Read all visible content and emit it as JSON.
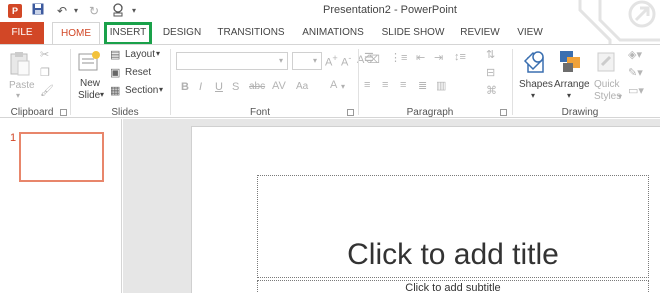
{
  "window": {
    "title": "Presentation2 - PowerPoint",
    "app_badge": "P"
  },
  "quick_access": [
    "save-icon",
    "undo-icon",
    "redo-icon",
    "present-icon"
  ],
  "tabs": [
    {
      "label": "FILE"
    },
    {
      "label": "HOME"
    },
    {
      "label": "INSERT"
    },
    {
      "label": "DESIGN"
    },
    {
      "label": "TRANSITIONS"
    },
    {
      "label": "ANIMATIONS"
    },
    {
      "label": "SLIDE SHOW"
    },
    {
      "label": "REVIEW"
    },
    {
      "label": "VIEW"
    }
  ],
  "ribbon": {
    "clipboard": {
      "paste": "Paste",
      "label": "Clipboard"
    },
    "slides": {
      "new_slide_1": "New",
      "new_slide_2": "Slide",
      "layout": "Layout",
      "reset": "Reset",
      "section": "Section",
      "label": "Slides"
    },
    "font": {
      "label": "Font",
      "bold": "B",
      "italic": "I",
      "underline": "U",
      "strike": "S",
      "abc": "abc",
      "size_a": "Aa"
    },
    "paragraph": {
      "label": "Paragraph"
    },
    "drawing": {
      "shapes": "Shapes",
      "arrange": "Arrange",
      "quick_1": "Quick",
      "quick_2": "Styles",
      "label": "Drawing"
    }
  },
  "thumbnails": [
    {
      "number": "1"
    }
  ],
  "slide": {
    "title_placeholder": "Click to add title",
    "subtitle_placeholder": "Click to add subtitle"
  },
  "colors": {
    "accent": "#d24726",
    "highlight": "#1aa14a"
  }
}
